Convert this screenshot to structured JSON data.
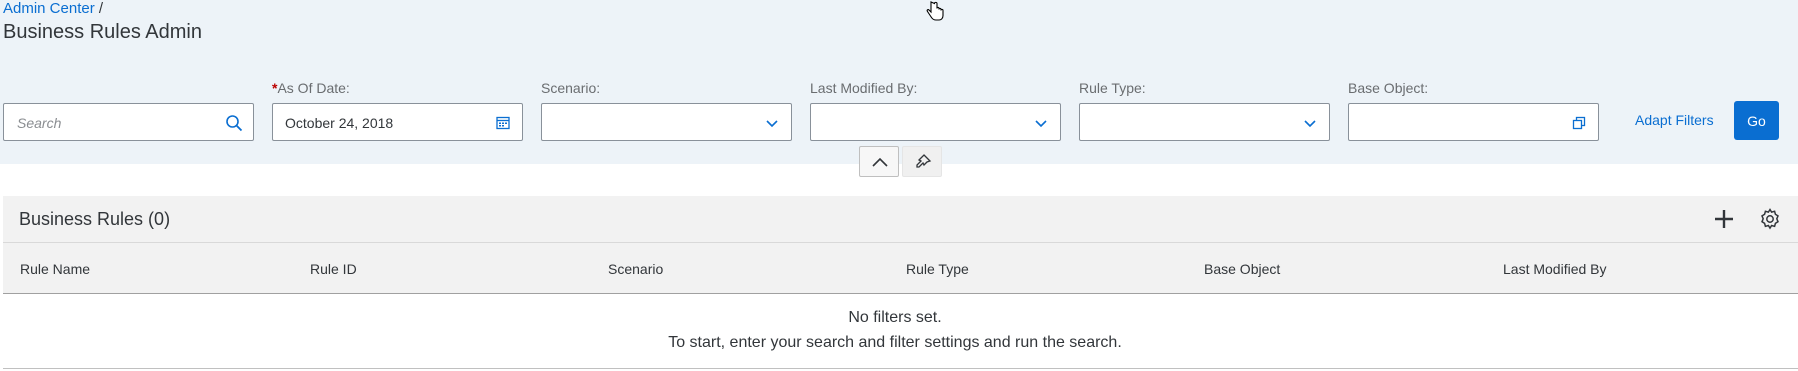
{
  "breadcrumb": {
    "link": "Admin Center",
    "separator": "/"
  },
  "page_title": "Business Rules Admin",
  "filters": {
    "search": {
      "placeholder": "Search",
      "value": ""
    },
    "as_of_date": {
      "required_marker": "*",
      "label": "As Of Date:",
      "value": "October 24, 2018"
    },
    "scenario": {
      "label": "Scenario:",
      "value": ""
    },
    "last_modified_by": {
      "label": "Last Modified By:",
      "value": ""
    },
    "rule_type": {
      "label": "Rule Type:",
      "value": ""
    },
    "base_object": {
      "label": "Base Object:",
      "value": ""
    },
    "adapt_filters_label": "Adapt Filters",
    "go_label": "Go"
  },
  "table": {
    "title": "Business Rules (0)",
    "columns": [
      "Rule Name",
      "Rule ID",
      "Scenario",
      "Rule Type",
      "Base Object",
      "Last Modified By"
    ],
    "empty_line1": "No filters set.",
    "empty_line2": "To start, enter your search and filter settings and run the search."
  },
  "colors": {
    "accent": "#0a6ed1",
    "header_bg": "#edf3f8",
    "toolbar_bg": "#f2f2f2"
  },
  "icons": [
    "search-icon",
    "calendar-icon",
    "chevron-down-icon",
    "value-help-icon",
    "collapse-icon",
    "pin-icon",
    "add-icon",
    "settings-icon",
    "hand-cursor-icon"
  ]
}
